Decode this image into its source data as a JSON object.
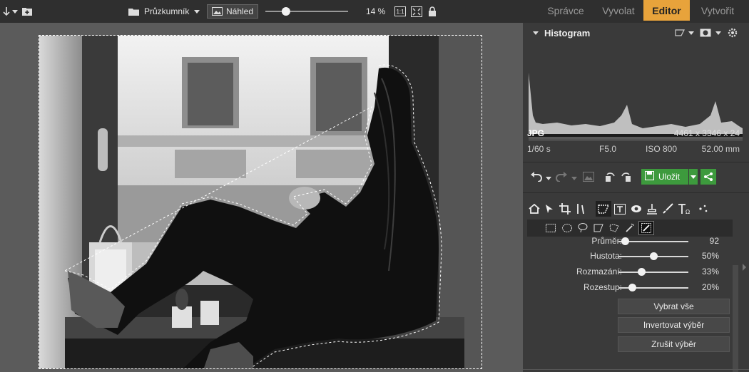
{
  "toolbar": {
    "browse_label": "Průzkumník",
    "preview_label": "Náhled",
    "zoom_value": "14 %",
    "zoom_slider_fraction": 0.22,
    "actual_size_label": "1:1"
  },
  "modes": [
    {
      "label": "Správce",
      "active": false
    },
    {
      "label": "Vyvolat",
      "active": false
    },
    {
      "label": "Editor",
      "active": true
    },
    {
      "label": "Vytvořit",
      "active": false
    }
  ],
  "histogram": {
    "title": "Histogram"
  },
  "info": {
    "format": "JPG",
    "dimensions": "4461 x 3346 x 24",
    "shutter": "1/60 s",
    "aperture": "F5.0",
    "iso": "ISO 800",
    "focal": "52.00 mm"
  },
  "actions": {
    "save_label": "Uložit"
  },
  "brush": {
    "sliders": [
      {
        "label": "Průměr:",
        "value": "92",
        "fraction": 0.1
      },
      {
        "label": "Hustota:",
        "value": "50%",
        "fraction": 0.5
      },
      {
        "label": "Rozmazání:",
        "value": "33%",
        "fraction": 0.33
      },
      {
        "label": "Rozestup:",
        "value": "20%",
        "fraction": 0.2
      }
    ],
    "buttons": {
      "select_all": "Vybrat vše",
      "invert": "Invertovat výběr",
      "deselect": "Zrušit výběr"
    }
  },
  "colors": {
    "accent": "#e8a33b",
    "save_green": "#3d9a3d",
    "panel_bg": "#3a3a3a",
    "toolbar_bg": "#2f2f2f"
  }
}
